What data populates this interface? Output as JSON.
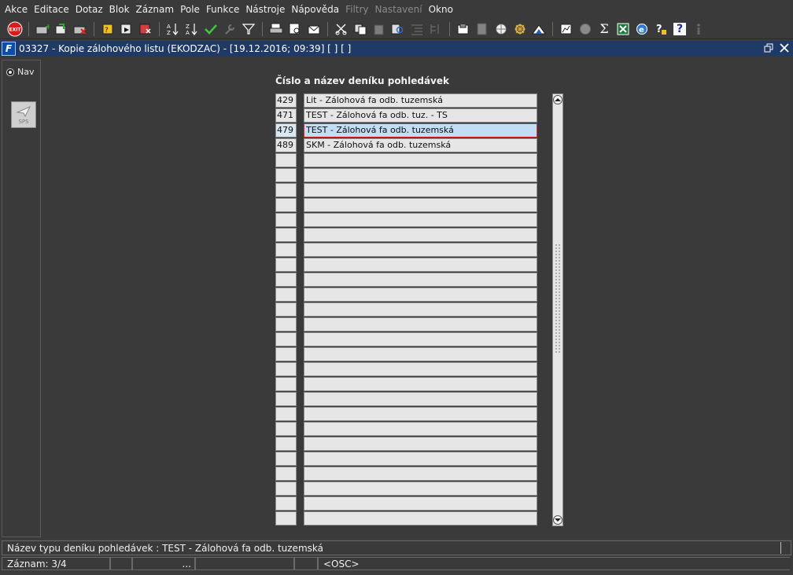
{
  "menu": [
    {
      "label": "Akce",
      "disabled": false
    },
    {
      "label": "Editace",
      "disabled": false
    },
    {
      "label": "Dotaz",
      "disabled": false
    },
    {
      "label": "Blok",
      "disabled": false
    },
    {
      "label": "Záznam",
      "disabled": false
    },
    {
      "label": "Pole",
      "disabled": false
    },
    {
      "label": "Funkce",
      "disabled": false
    },
    {
      "label": "Nástroje",
      "disabled": false
    },
    {
      "label": "Nápověda",
      "disabled": false
    },
    {
      "label": "Filtry",
      "disabled": true
    },
    {
      "label": "Nastavení",
      "disabled": true
    },
    {
      "label": "Okno",
      "disabled": false
    }
  ],
  "toolbar": {
    "exit_label": "EXIT",
    "sum_glyph": "Σ",
    "help_glyph": "?"
  },
  "window": {
    "icon_label": "F",
    "title": "03327 - Kopie zálohového listu (EKODZAC) - [19.12.2016; 09:39]  [ ]  [ ]"
  },
  "left_panel": {
    "nav_label": "Nav",
    "sps_label": "SPS"
  },
  "form": {
    "field_title": "Číslo a název deníku pohledávek",
    "rows": [
      {
        "num": "429",
        "name": "Lit - Zálohová fa odb. tuzemská",
        "selected": false
      },
      {
        "num": "471",
        "name": "TEST - Zálohová fa odb. tuz. - TS",
        "selected": false
      },
      {
        "num": "479",
        "name": "TEST - Zálohová fa odb. tuzemská",
        "selected": true
      },
      {
        "num": "489",
        "name": "SKM - Zálohová fa odb. tuzemská",
        "selected": false
      },
      {
        "num": "",
        "name": "",
        "selected": false
      },
      {
        "num": "",
        "name": "",
        "selected": false
      },
      {
        "num": "",
        "name": "",
        "selected": false
      },
      {
        "num": "",
        "name": "",
        "selected": false
      },
      {
        "num": "",
        "name": "",
        "selected": false
      },
      {
        "num": "",
        "name": "",
        "selected": false
      },
      {
        "num": "",
        "name": "",
        "selected": false
      },
      {
        "num": "",
        "name": "",
        "selected": false
      },
      {
        "num": "",
        "name": "",
        "selected": false
      },
      {
        "num": "",
        "name": "",
        "selected": false
      },
      {
        "num": "",
        "name": "",
        "selected": false
      },
      {
        "num": "",
        "name": "",
        "selected": false
      },
      {
        "num": "",
        "name": "",
        "selected": false
      },
      {
        "num": "",
        "name": "",
        "selected": false
      },
      {
        "num": "",
        "name": "",
        "selected": false
      },
      {
        "num": "",
        "name": "",
        "selected": false
      },
      {
        "num": "",
        "name": "",
        "selected": false
      },
      {
        "num": "",
        "name": "",
        "selected": false
      },
      {
        "num": "",
        "name": "",
        "selected": false
      },
      {
        "num": "",
        "name": "",
        "selected": false
      },
      {
        "num": "",
        "name": "",
        "selected": false
      },
      {
        "num": "",
        "name": "",
        "selected": false
      },
      {
        "num": "",
        "name": "",
        "selected": false
      },
      {
        "num": "",
        "name": "",
        "selected": false
      },
      {
        "num": "",
        "name": "",
        "selected": false
      }
    ]
  },
  "status": {
    "hint": "Název typu deníku pohledávek : TEST - Zálohová fa odb. tuzemská",
    "record": "Záznam: 3/4",
    "ellipsis": "...",
    "mode": "<OSC>"
  },
  "colors": {
    "selected_row_bg": "#c3ddf5",
    "selected_row_border": "#d03030",
    "title_bar_bg": "#1f3a66"
  }
}
